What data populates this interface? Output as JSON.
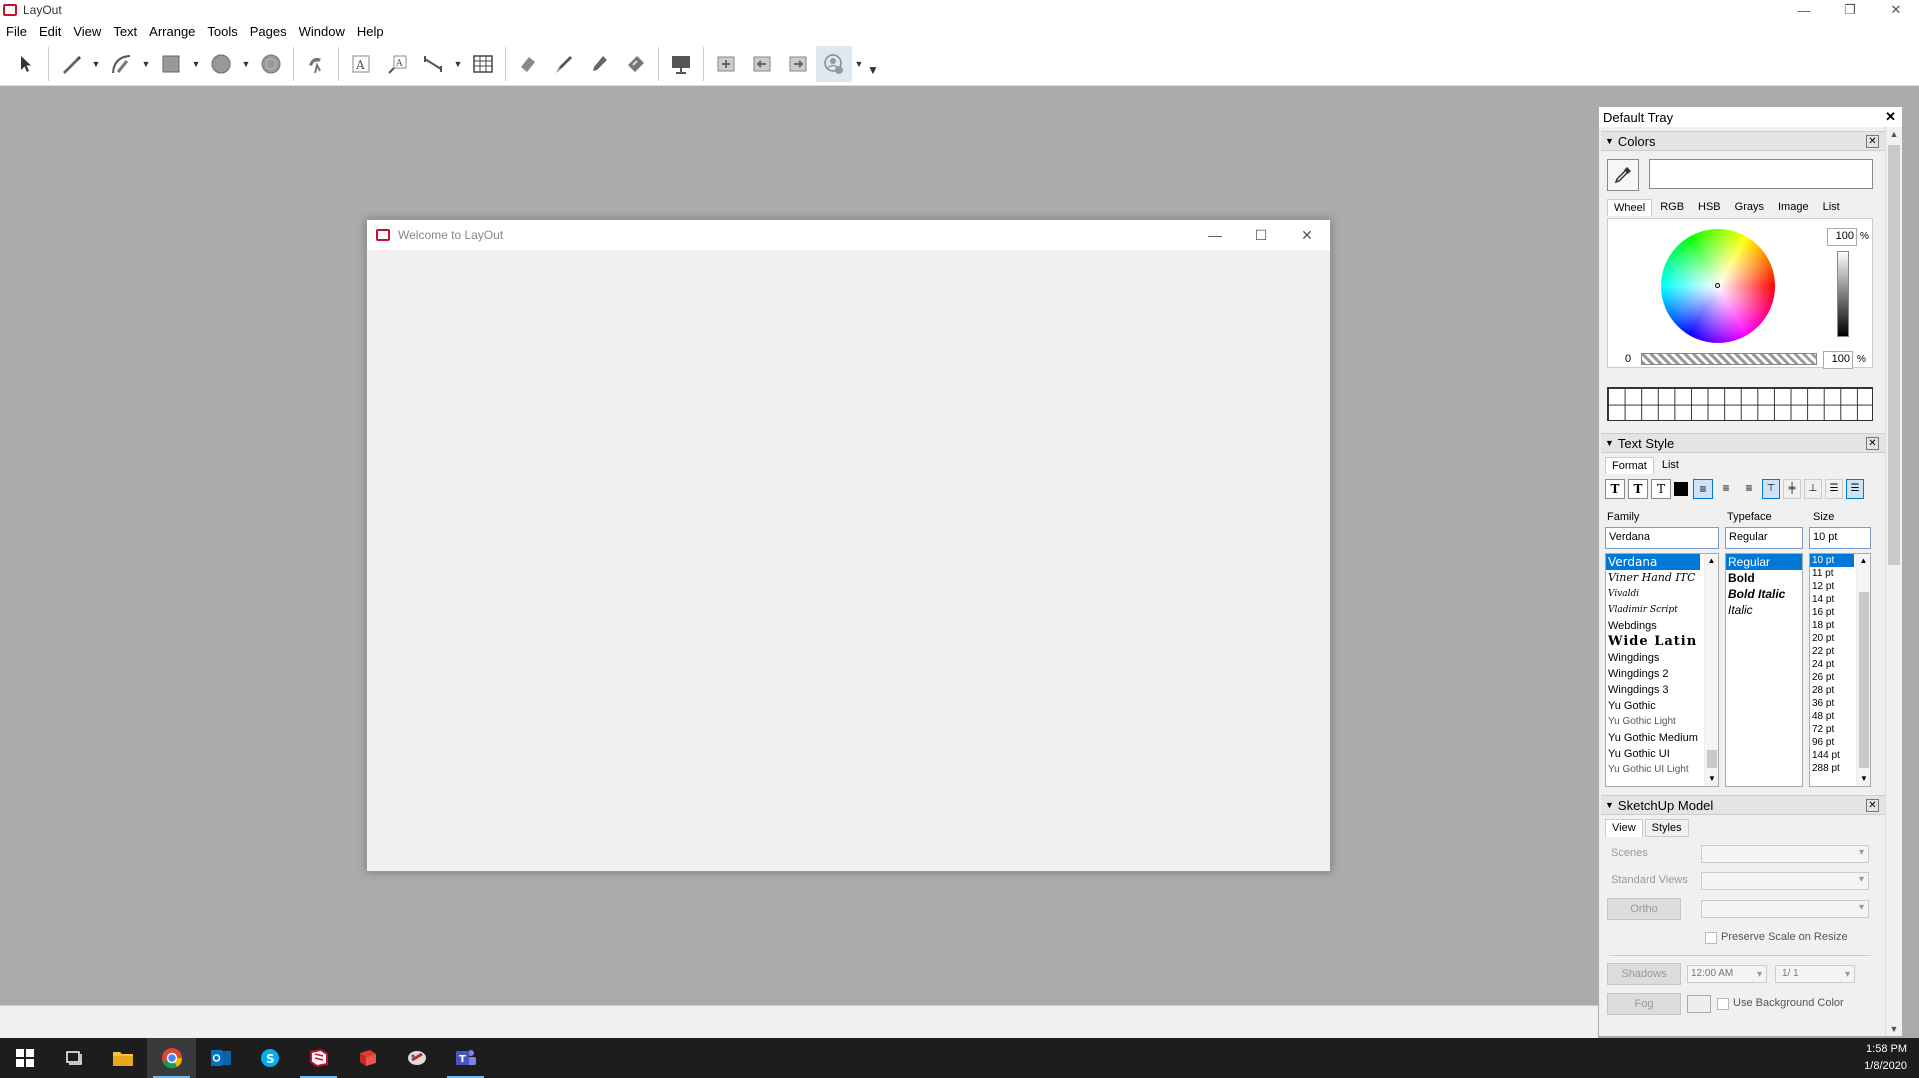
{
  "app": {
    "title": "LayOut"
  },
  "window_controls": {
    "minimize": "—",
    "restore": "❐",
    "close": "✕"
  },
  "menu": [
    "File",
    "Edit",
    "View",
    "Text",
    "Arrange",
    "Tools",
    "Pages",
    "Window",
    "Help"
  ],
  "toolbar": {
    "icons": [
      "select-tool-icon",
      "line-tool-icon",
      "arc-tool-icon",
      "rectangle-tool-icon",
      "circle-tool-icon",
      "polygon-tool-icon",
      "offset-tool-icon",
      "text-tool-icon",
      "label-tool-icon",
      "dimension-tool-icon",
      "table-tool-icon",
      "erase-tool-icon",
      "style-tool-icon",
      "split-tool-icon",
      "join-tool-icon",
      "presentation-icon",
      "add-page-icon",
      "previous-page-icon",
      "next-page-icon",
      "collaborate-icon"
    ]
  },
  "welcome_dialog": {
    "title": "Welcome to LayOut"
  },
  "tray": {
    "title": "Default Tray",
    "colors": {
      "title": "Colors",
      "tabs": [
        "Wheel",
        "RGB",
        "HSB",
        "Grays",
        "Image",
        "List"
      ],
      "active_tab": "Wheel",
      "brightness": "100",
      "opacity": "100",
      "percent": "%",
      "zero": "0"
    },
    "text_style": {
      "title": "Text Style",
      "tabs": [
        "Format",
        "List"
      ],
      "family_label": "Family",
      "typeface_label": "Typeface",
      "size_label": "Size",
      "family_value": "Verdana",
      "typeface_value": "Regular",
      "size_value": "10 pt",
      "families": [
        "Verdana",
        "Viner Hand ITC",
        "Vivaldi",
        "Vladimir Script",
        "Webdings",
        "Wide Latin",
        "Wingdings",
        "Wingdings 2",
        "Wingdings 3",
        "Yu Gothic",
        "Yu Gothic Light",
        "Yu Gothic Medium",
        "Yu Gothic UI",
        "Yu Gothic UI Light"
      ],
      "typefaces": [
        "Regular",
        "Bold",
        "Bold Italic",
        "Italic"
      ],
      "sizes": [
        "10 pt",
        "11 pt",
        "12 pt",
        "14 pt",
        "16 pt",
        "18 pt",
        "20 pt",
        "22 pt",
        "24 pt",
        "26 pt",
        "28 pt",
        "36 pt",
        "48 pt",
        "72 pt",
        "96 pt",
        "144 pt",
        "288 pt"
      ]
    },
    "sketchup_model": {
      "title": "SketchUp Model",
      "tabs": [
        "View",
        "Styles"
      ],
      "scenes_label": "Scenes",
      "standard_views_label": "Standard Views",
      "ortho_label": "Ortho",
      "preserve_scale_label": "Preserve Scale on Resize",
      "shadows_label": "Shadows",
      "time_value": "12:00 AM",
      "date_value": "1/ 1",
      "fog_label": "Fog",
      "use_bg_label": "Use Background Color"
    }
  },
  "taskbar": {
    "time": "1:58 PM",
    "date": "1/8/2020"
  },
  "colors": {
    "accent": "#0078d7",
    "brand": "#c8102e",
    "canvas": "#ababab"
  }
}
